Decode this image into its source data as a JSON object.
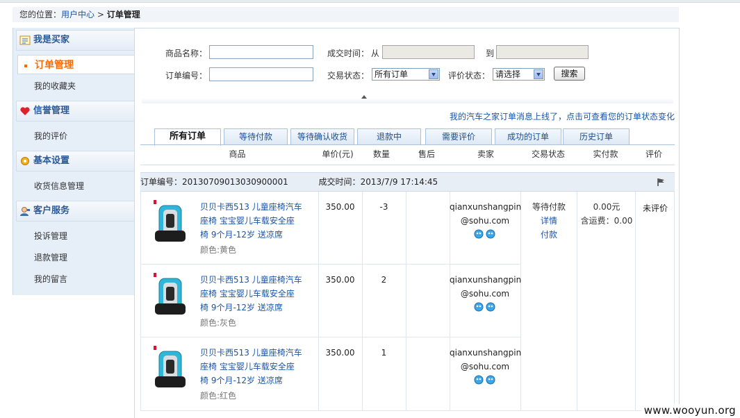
{
  "breadcrumb": {
    "prefix": "您的位置：",
    "link": "用户中心",
    "sep": " > ",
    "current": "订单管理"
  },
  "sidebar": {
    "sections": [
      {
        "title": "我是买家",
        "icon": "notepad-icon",
        "items": [
          "订单管理",
          "我的收藏夹"
        ]
      },
      {
        "title": "信誉管理",
        "icon": "heart-icon",
        "items": [
          "我的评价"
        ]
      },
      {
        "title": "基本设置",
        "icon": "gear-icon",
        "items": [
          "收货信息管理"
        ]
      },
      {
        "title": "客户服务",
        "icon": "customer-service-icon",
        "items": [
          "投诉管理",
          "退款管理",
          "我的留言"
        ]
      }
    ]
  },
  "search": {
    "product_name_label": "商品名称：",
    "deal_time_label": "成交时间：",
    "from_label": "从",
    "to_label": "到",
    "order_no_label": "订单编号：",
    "trade_status_label": "交易状态：",
    "trade_status_value": "所有订单",
    "review_status_label": "评价状态：",
    "review_status_value": "请选择",
    "search_button": "搜索"
  },
  "notice": "我的汽车之家订单消息上线了，点击可查看您的订单状态变化",
  "tabs": [
    "所有订单",
    "等待付款",
    "等待确认收货",
    "退款中",
    "需要评价",
    "成功的订单",
    "历史订单"
  ],
  "columns": [
    "商品",
    "单价(元)",
    "数量",
    "售后",
    "卖家",
    "交易状态",
    "实付款",
    "评价"
  ],
  "order": {
    "order_no_label": "订单编号：",
    "order_no": "20130709013030900001",
    "deal_time_label": "成交时间：",
    "deal_time": "2013/7/9 17:14:45",
    "status": "等待付款",
    "detail_link": "详情",
    "pay_link": "付款",
    "paid_amount": "0.00元",
    "shipping": "含运费：0.00",
    "review": "未评价",
    "items": [
      {
        "name_line1": "贝贝卡西513 儿童座椅汽车",
        "name_line2": "座椅 宝宝婴儿车载安全座",
        "name_line3": "椅 9个月-12岁 送凉席",
        "color": "颜色:黄色",
        "price": "350.00",
        "qty": "-3",
        "seller_line1": "qianxunshangpin",
        "seller_line2": "@sohu.com"
      },
      {
        "name_line1": "贝贝卡西513 儿童座椅汽车",
        "name_line2": "座椅 宝宝婴儿车载安全座",
        "name_line3": "椅 9个月-12岁 送凉席",
        "color": "颜色:灰色",
        "price": "350.00",
        "qty": "2",
        "seller_line1": "qianxunshangpin",
        "seller_line2": "@sohu.com"
      },
      {
        "name_line1": "贝贝卡西513 儿童座椅汽车",
        "name_line2": "座椅 宝宝婴儿车载安全座",
        "name_line3": "椅 9个月-12岁 送凉席",
        "color": "颜色:红色",
        "price": "350.00",
        "qty": "1",
        "seller_line1": "qianxunshangpin",
        "seller_line2": "@sohu.com"
      }
    ]
  },
  "watermark": "www.wooyun.org"
}
